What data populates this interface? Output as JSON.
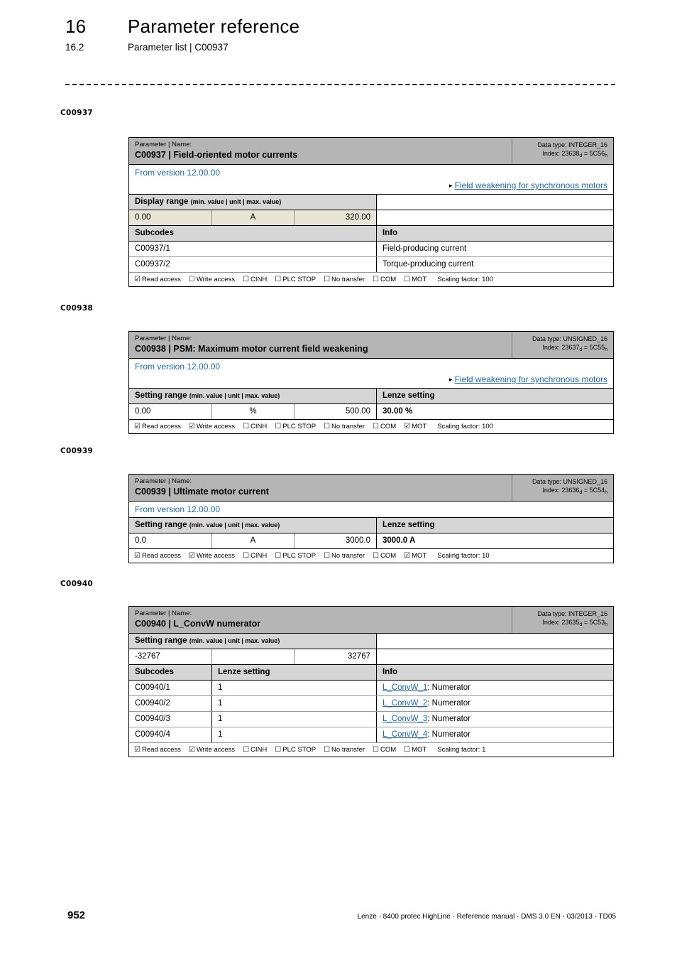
{
  "header": {
    "chapter_number": "16",
    "chapter_title": "Parameter reference",
    "section_number": "16.2",
    "section_title": "Parameter list | C00937"
  },
  "margin_labels": {
    "c937": "C00937",
    "c938": "C00938",
    "c939": "C00939",
    "c940": "C00940"
  },
  "labels": {
    "parameter_name_caption": "Parameter | Name:",
    "data_type_prefix": "Data type: ",
    "index_prefix": "Index: ",
    "display_range": "Display range",
    "setting_range": "Setting range",
    "range_note": "(min. value | unit | max. value)",
    "lenze_setting": "Lenze setting",
    "subcodes": "Subcodes",
    "info": "Info",
    "read_access": "Read access",
    "write_access": "Write access",
    "cinh": "CINH",
    "plc_stop": "PLC STOP",
    "no_transfer": "No transfer",
    "com": "COM",
    "mot": "MOT",
    "scaling_factor_prefix": "Scaling factor: ",
    "checked_glyph": "☑",
    "unchecked_glyph": "☐",
    "xref_arrow": "▸"
  },
  "colors": {
    "title_band": "#b5b5b5",
    "section_band": "#d6d6d6",
    "value_highlight": "#e8e5d7",
    "link_blue": "#1b6bb5",
    "page_background": "#ffffff"
  },
  "parameters": [
    {
      "code": "C00937",
      "title": "C00937 | Field-oriented motor currents",
      "data_type": "INTEGER_16",
      "index_dec": "23638",
      "index_hex": "5C56",
      "version": "From version 12.00.00",
      "xref": "Field weakening for synchronous motors",
      "range_kind": "Display range",
      "range_min": "0.00",
      "range_unit": "A",
      "range_max": "320.00",
      "lenze_setting": "",
      "highlight_values": true,
      "subcodes": [
        {
          "code": "C00937/1",
          "lenze": "",
          "info": "Field-producing current",
          "link": ""
        },
        {
          "code": "C00937/2",
          "lenze": "",
          "info": "Torque-producing current",
          "link": ""
        }
      ],
      "access": {
        "read": true,
        "write": false,
        "cinh": false,
        "plc_stop": false,
        "no_transfer": false,
        "com": false,
        "mot": false,
        "scaling_factor": "100"
      }
    },
    {
      "code": "C00938",
      "title": "C00938 | PSM: Maximum motor current field weakening",
      "data_type": "UNSIGNED_16",
      "index_dec": "23637",
      "index_hex": "5C55",
      "version": "From version 12.00.00",
      "xref": "Field weakening for synchronous motors",
      "range_kind": "Setting range",
      "range_min": "0.00",
      "range_unit": "%",
      "range_max": "500.00",
      "lenze_setting": "30.00 %",
      "highlight_values": false,
      "subcodes": [],
      "access": {
        "read": true,
        "write": true,
        "cinh": false,
        "plc_stop": false,
        "no_transfer": false,
        "com": false,
        "mot": true,
        "scaling_factor": "100"
      }
    },
    {
      "code": "C00939",
      "title": "C00939 | Ultimate motor current",
      "data_type": "UNSIGNED_16",
      "index_dec": "23636",
      "index_hex": "5C54",
      "version": "From version 12.00.00",
      "xref": "",
      "range_kind": "Setting range",
      "range_min": "0.0",
      "range_unit": "A",
      "range_max": "3000.0",
      "lenze_setting": "3000.0 A",
      "highlight_values": false,
      "subcodes": [],
      "access": {
        "read": true,
        "write": true,
        "cinh": false,
        "plc_stop": false,
        "no_transfer": false,
        "com": false,
        "mot": true,
        "scaling_factor": "10"
      }
    },
    {
      "code": "C00940",
      "title": "C00940 | L_ConvW numerator",
      "data_type": "INTEGER_16",
      "index_dec": "23635",
      "index_hex": "5C53",
      "version": "",
      "xref": "",
      "range_kind": "Setting range",
      "range_min": "-32767",
      "range_unit": "",
      "range_max": "32767",
      "lenze_setting": "",
      "highlight_values": false,
      "subcodes": [
        {
          "code": "C00940/1",
          "lenze": "1",
          "info": ": Numerator",
          "link": "L_ConvW_1"
        },
        {
          "code": "C00940/2",
          "lenze": "1",
          "info": ": Numerator",
          "link": "L_ConvW_2"
        },
        {
          "code": "C00940/3",
          "lenze": "1",
          "info": ": Numerator",
          "link": "L_ConvW_3"
        },
        {
          "code": "C00940/4",
          "lenze": "1",
          "info": ": Numerator",
          "link": "L_ConvW_4"
        }
      ],
      "access": {
        "read": true,
        "write": true,
        "cinh": false,
        "plc_stop": false,
        "no_transfer": false,
        "com": false,
        "mot": false,
        "scaling_factor": "1"
      }
    }
  ],
  "footer": {
    "page_number": "952",
    "note": "Lenze · 8400 protec HighLine · Reference manual · DMS 3.0 EN · 03/2013 · TD05"
  }
}
